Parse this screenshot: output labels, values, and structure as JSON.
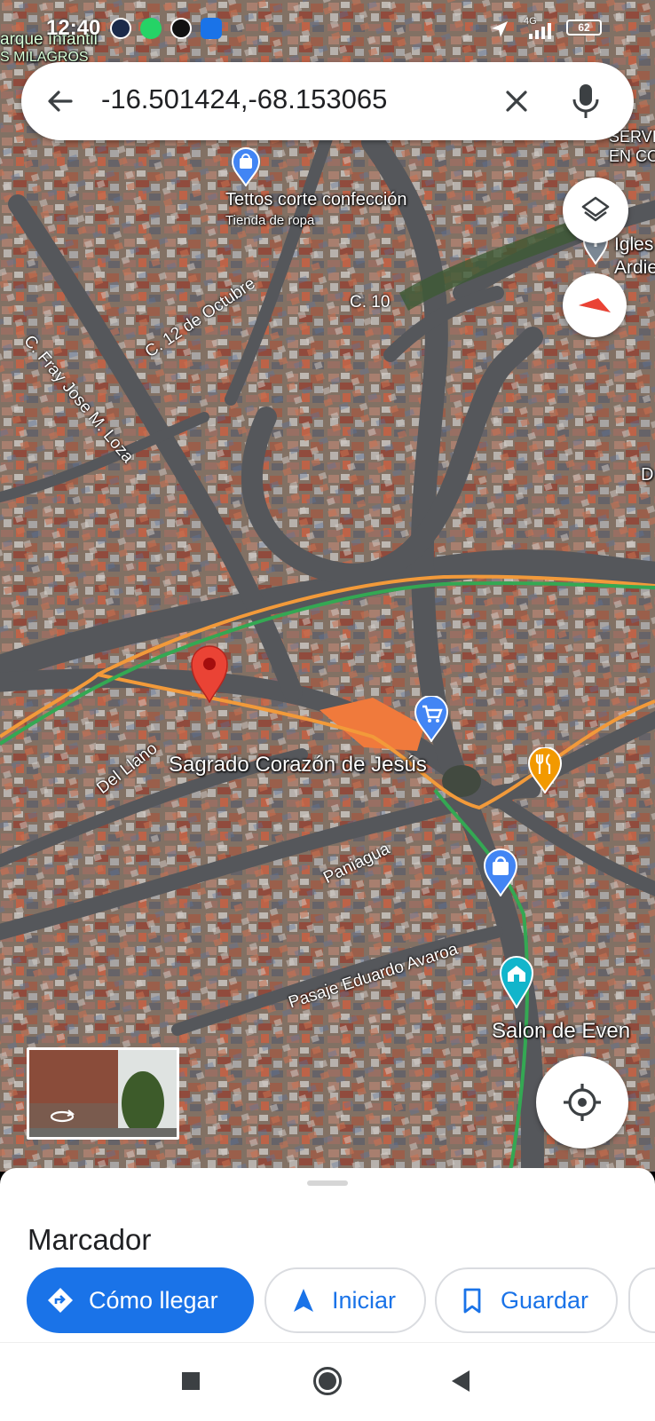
{
  "status_bar": {
    "time": "12:40",
    "network": "4G",
    "battery": "62",
    "app_icons": [
      "alarm-icon",
      "whatsapp-icon",
      "app-icon",
      "message-icon"
    ]
  },
  "search": {
    "query": "-16.501424,-68.153065"
  },
  "map": {
    "places": [
      {
        "name": "Tettos corte confección",
        "sub": "Tienda de ropa"
      },
      {
        "name": "Sagrado Corazón de Jesús"
      },
      {
        "name": "Salon de Even"
      }
    ],
    "roads": [
      "C. 12 de Octubre",
      "C. 10",
      "C. Fray Jose M. Loza",
      "Del Llano",
      "Paniagua",
      "Pasaje Eduardo Avaroa"
    ],
    "edge_labels": {
      "top_left": "arque Infantil",
      "top_left_2": "S MILAGROS",
      "top_right_1": "SERVI",
      "top_right_2": "EN CO",
      "church_1": "Igles",
      "church_2": "Ardie",
      "right_d": "D"
    }
  },
  "sheet": {
    "title": "Marcador",
    "actions": {
      "directions": "Cómo llegar",
      "start": "Iniciar",
      "save": "Guardar"
    }
  },
  "colors": {
    "accent": "#1a73e8",
    "pin": "#ea4335",
    "route_orange": "#f29a3a",
    "route_green": "#34a853"
  }
}
